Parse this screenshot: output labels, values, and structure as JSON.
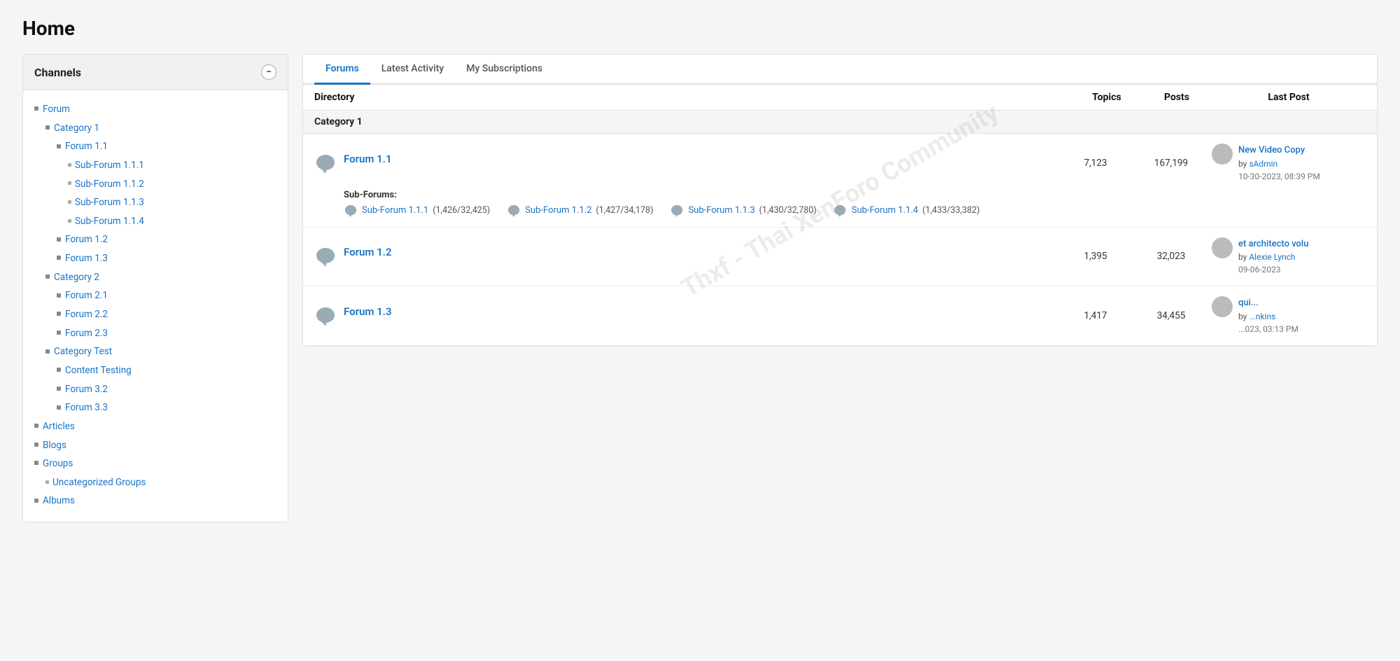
{
  "page": {
    "title": "Home"
  },
  "channels": {
    "title": "Channels",
    "collapse_label": "−",
    "tree": [
      {
        "level": 0,
        "label": "Forum",
        "link": true,
        "bullet": "normal"
      },
      {
        "level": 1,
        "label": "Category 1",
        "link": true,
        "bullet": "normal"
      },
      {
        "level": 2,
        "label": "Forum 1.1",
        "link": true,
        "bullet": "normal"
      },
      {
        "level": 3,
        "label": "Sub-Forum 1.1.1",
        "link": true,
        "bullet": "small"
      },
      {
        "level": 3,
        "label": "Sub-Forum 1.1.2",
        "link": true,
        "bullet": "small"
      },
      {
        "level": 3,
        "label": "Sub-Forum 1.1.3",
        "link": true,
        "bullet": "small"
      },
      {
        "level": 3,
        "label": "Sub-Forum 1.1.4",
        "link": true,
        "bullet": "small"
      },
      {
        "level": 2,
        "label": "Forum 1.2",
        "link": true,
        "bullet": "normal"
      },
      {
        "level": 2,
        "label": "Forum 1.3",
        "link": true,
        "bullet": "normal"
      },
      {
        "level": 1,
        "label": "Category 2",
        "link": true,
        "bullet": "normal"
      },
      {
        "level": 2,
        "label": "Forum 2.1",
        "link": true,
        "bullet": "normal"
      },
      {
        "level": 2,
        "label": "Forum 2.2",
        "link": true,
        "bullet": "normal"
      },
      {
        "level": 2,
        "label": "Forum 2.3",
        "link": true,
        "bullet": "normal"
      },
      {
        "level": 1,
        "label": "Category Test",
        "link": true,
        "bullet": "normal"
      },
      {
        "level": 2,
        "label": "Content Testing",
        "link": true,
        "bullet": "normal"
      },
      {
        "level": 2,
        "label": "Forum 3.2",
        "link": true,
        "bullet": "normal"
      },
      {
        "level": 2,
        "label": "Forum 3.3",
        "link": true,
        "bullet": "normal"
      },
      {
        "level": 0,
        "label": "Articles",
        "link": true,
        "bullet": "normal"
      },
      {
        "level": 0,
        "label": "Blogs",
        "link": true,
        "bullet": "normal"
      },
      {
        "level": 0,
        "label": "Groups",
        "link": true,
        "bullet": "normal"
      },
      {
        "level": 1,
        "label": "Uncategorized Groups",
        "link": true,
        "bullet": "small"
      },
      {
        "level": 0,
        "label": "Albums",
        "link": true,
        "bullet": "normal"
      }
    ]
  },
  "tabs": {
    "items": [
      {
        "label": "Forums",
        "active": true
      },
      {
        "label": "Latest Activity",
        "active": false
      },
      {
        "label": "My Subscriptions",
        "active": false
      }
    ]
  },
  "directory": {
    "columns": [
      "Directory",
      "Topics",
      "Posts",
      "Last Post"
    ],
    "categories": [
      {
        "name": "Category 1",
        "forums": [
          {
            "name": "Forum 1.1",
            "topics": "7,123",
            "posts": "167,199",
            "last_post_title": "New Video Copy",
            "last_post_by": "sAdmin",
            "last_post_date": "10-30-2023, 08:39 PM",
            "sub_forums": [
              {
                "name": "Sub-Forum 1.1.1",
                "counts": "(1,426/32,425)"
              },
              {
                "name": "Sub-Forum 1.1.2",
                "counts": "(1,427/34,178)"
              },
              {
                "name": "Sub-Forum 1.1.3",
                "counts": "(1,430/32,780)"
              },
              {
                "name": "Sub-Forum 1.1.4",
                "counts": "(1,433/33,382)"
              }
            ]
          },
          {
            "name": "Forum 1.2",
            "topics": "1,395",
            "posts": "32,023",
            "last_post_title": "et architecto volu",
            "last_post_by": "Alexie Lynch",
            "last_post_date": "09-06-2023",
            "sub_forums": []
          },
          {
            "name": "Forum 1.3",
            "topics": "1,417",
            "posts": "34,455",
            "last_post_title": "qui...",
            "last_post_by": "...nkins",
            "last_post_date": "...023, 03:13 PM",
            "sub_forums": []
          }
        ]
      }
    ]
  },
  "watermark": "Thxf - Thai XenForo Community"
}
